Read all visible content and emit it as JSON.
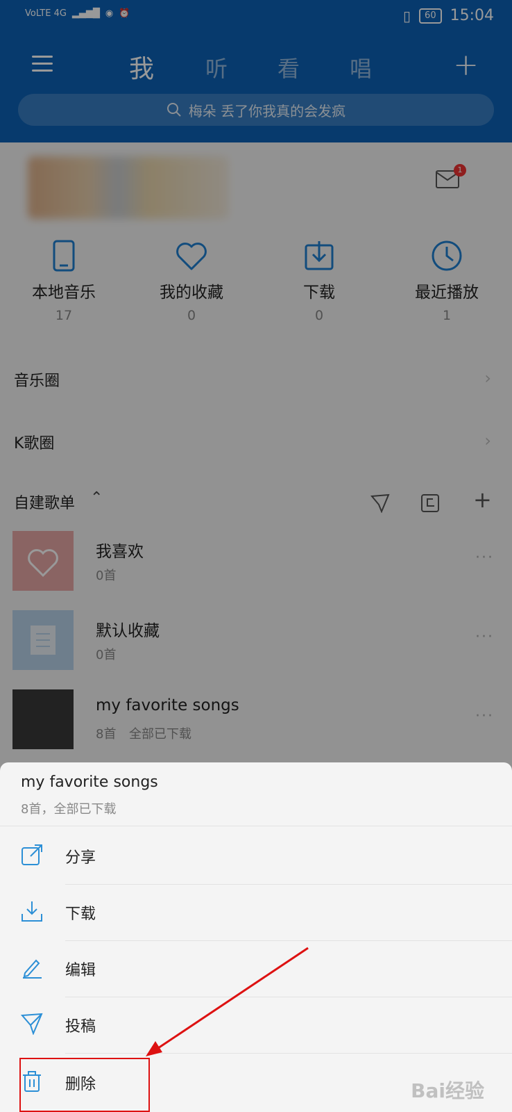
{
  "status_bar": {
    "left_text": "VoLTE 4G",
    "time": "15:04",
    "battery": "60"
  },
  "header": {
    "tabs": [
      "我",
      "听",
      "看",
      "唱"
    ],
    "search_placeholder": "梅朵 丢了你我真的会发疯"
  },
  "profile": {
    "mail_badge": "1"
  },
  "quick_access": [
    {
      "label": "本地音乐",
      "count": "17",
      "icon": "phone-icon"
    },
    {
      "label": "我的收藏",
      "count": "0",
      "icon": "heart-icon"
    },
    {
      "label": "下载",
      "count": "0",
      "icon": "download-icon"
    },
    {
      "label": "最近播放",
      "count": "1",
      "icon": "clock-icon"
    }
  ],
  "sections": {
    "music_circle": "音乐圈",
    "k_circle": "K歌圈",
    "playlists_header": "自建歌单"
  },
  "playlists": [
    {
      "title": "我喜欢",
      "sub": "0首"
    },
    {
      "title": "默认收藏",
      "sub": "0首"
    },
    {
      "title": "my favorite songs",
      "sub": "8首",
      "status": "全部已下载"
    }
  ],
  "sheet": {
    "title": "my favorite songs",
    "subtitle": "8首，全部已下载",
    "options": [
      {
        "label": "分享",
        "icon": "share-icon"
      },
      {
        "label": "下载",
        "icon": "download-icon"
      },
      {
        "label": "编辑",
        "icon": "edit-icon"
      },
      {
        "label": "投稿",
        "icon": "send-icon"
      },
      {
        "label": "删除",
        "icon": "trash-icon"
      }
    ]
  },
  "watermark": "Bai经验",
  "colors": {
    "brand_blue": "#0d62b6",
    "icon_blue": "#1f7fd1",
    "highlight_red": "#d11111"
  }
}
